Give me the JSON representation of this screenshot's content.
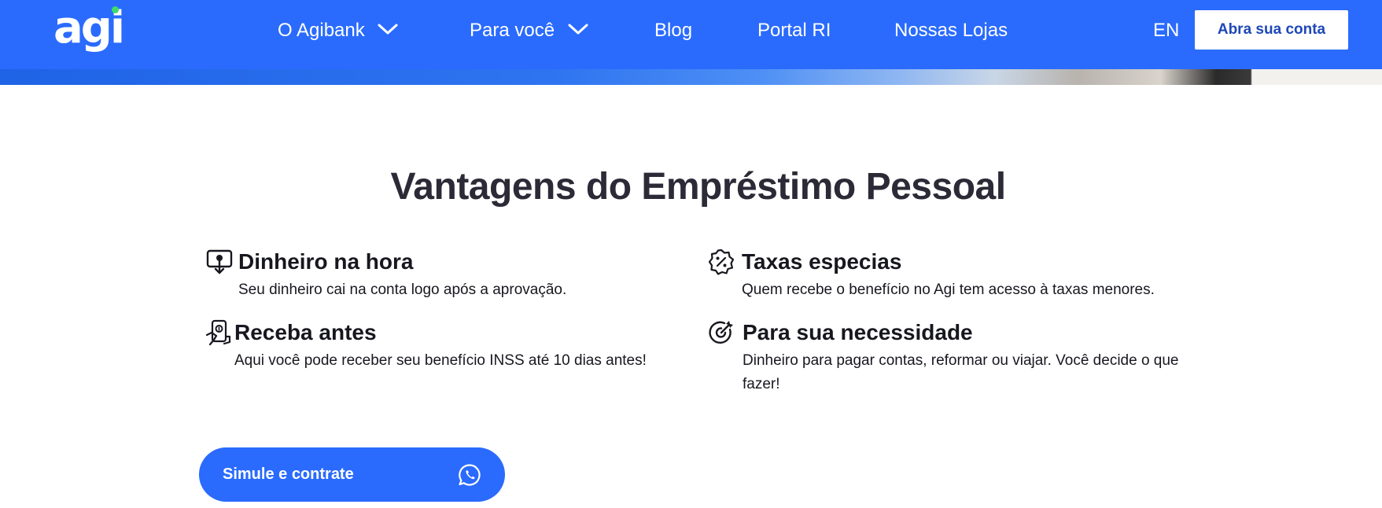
{
  "header": {
    "logo_text": "agi",
    "nav": [
      {
        "label": "O Agibank",
        "has_dropdown": true
      },
      {
        "label": "Para você",
        "has_dropdown": true
      },
      {
        "label": "Blog",
        "has_dropdown": false
      },
      {
        "label": "Portal RI",
        "has_dropdown": false
      },
      {
        "label": "Nossas Lojas",
        "has_dropdown": false
      }
    ],
    "language": "EN",
    "cta_label": "Abra sua conta"
  },
  "section": {
    "title": "Vantagens do Empréstimo Pessoal",
    "features": [
      {
        "icon": "money-download-icon",
        "title": "Dinheiro na hora",
        "description": "Seu dinheiro cai na conta logo após a aprovação."
      },
      {
        "icon": "percent-badge-icon",
        "title": "Taxas especias",
        "description": "Quem recebe o benefício no Agi tem acesso à taxas menores."
      },
      {
        "icon": "hand-phone-money-icon",
        "title": "Receba antes",
        "description": "Aqui você pode receber seu benefício INSS até 10 dias antes!"
      },
      {
        "icon": "target-icon",
        "title": "Para sua necessidade",
        "description": "Dinheiro para pagar contas, reformar ou viajar. Você decide o que fazer!"
      }
    ],
    "cta_label": "Simule e contrate",
    "cta_icon": "whatsapp-icon"
  },
  "colors": {
    "brand_blue": "#2a6bfe",
    "title_text": "#2b2a36",
    "body_text": "#17171f",
    "logo_dot_green": "#3ddc6b",
    "cta_top_text": "#1e47b8"
  }
}
